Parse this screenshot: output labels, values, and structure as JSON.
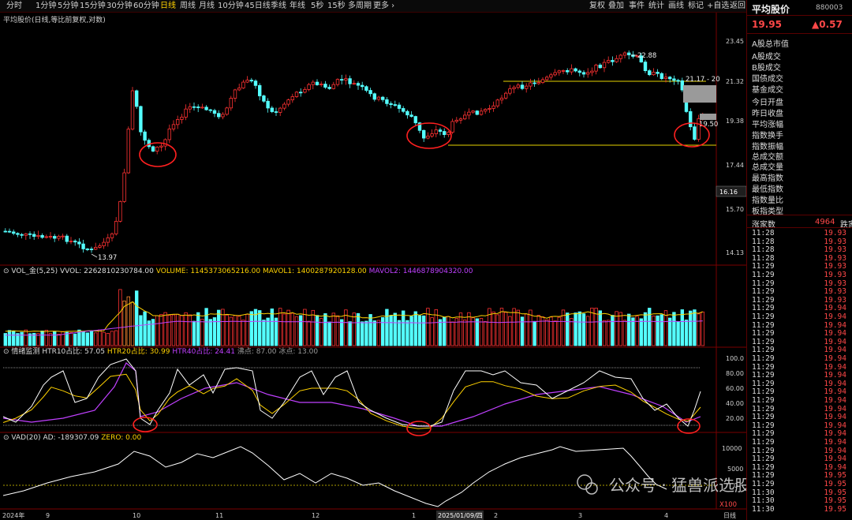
{
  "toolbar": {
    "periods": [
      "分时",
      "1分钟",
      "5分钟",
      "15分钟",
      "30分钟",
      "60分钟",
      "日线",
      "周线",
      "月线",
      "10分钟",
      "45日线",
      "季线",
      "年线",
      "5秒",
      "15秒",
      "多周期",
      "更多 ›"
    ],
    "active_period": "日线",
    "right_buttons": [
      "复权",
      "叠加",
      "事件",
      "统计",
      "画线",
      "标记",
      "+自选",
      "返回"
    ]
  },
  "main_chart": {
    "title": "平均股价(日线,等比前复权,对数)",
    "price_axis": [
      "23.45",
      "21.32",
      "19.38",
      "17.44",
      "15.70",
      "14.13"
    ],
    "current_price_tag": "16.16",
    "annotations": {
      "high": "22.88",
      "low": "13.97",
      "line_right": "21.17 - 20",
      "right_mid": "19.50"
    }
  },
  "volume_panel": {
    "title": "VOL_金(5,25)",
    "vvol": "VVOL: 2262810230784.00",
    "volume": "VOLUME: 1145373065216.00",
    "mavol1": "MAVOL1: 1400287920128.00",
    "mavol2": "MAVOL2: 1446878904320.00"
  },
  "htr_panel": {
    "title": "情绪监测",
    "htr10": "HTR10占比: 57.05",
    "htr20": "HTR20占比: 30.99",
    "htr40": "HTR40占比: 24.41",
    "boil": "沸点: 87.00",
    "freeze": "冰点: 13.00",
    "axis": [
      "100.0",
      "80.00",
      "60.00",
      "40.00",
      "20.00"
    ]
  },
  "vad_panel": {
    "title": "VAD(20)",
    "ad": "AD: -189307.09",
    "zero": "ZERO: 0.00",
    "axis": [
      "10000",
      "5000",
      "0"
    ],
    "unit": "X100"
  },
  "date_axis": {
    "labels": [
      "2024年",
      "9",
      "10",
      "11",
      "12",
      "1",
      "2025/01/09/四",
      "2",
      "3",
      "4"
    ],
    "period_label": "日线"
  },
  "watermark": "公众号 · 猛兽派选股",
  "right_panel": {
    "name": "平均股价",
    "code": "880003",
    "price": "19.95",
    "change": "▲0.57",
    "fields": [
      "A股总市值",
      "A股成交",
      "B股成交",
      "国债成交",
      "基金成交",
      "今日开盘",
      "昨日收盘",
      "平均涨幅",
      "指数换手",
      "指数振幅",
      "总成交额",
      "总成交量",
      "最高指数",
      "最低指数",
      "指数量比",
      "板指类型"
    ],
    "rise_label": "涨家数",
    "rise_count": "4964",
    "fall_label": "跌家",
    "ticks": [
      {
        "t": "11:28",
        "p": "19.93"
      },
      {
        "t": "11:28",
        "p": "19.93"
      },
      {
        "t": "11:28",
        "p": "19.93"
      },
      {
        "t": "11:28",
        "p": "19.93"
      },
      {
        "t": "11:29",
        "p": "19.93"
      },
      {
        "t": "11:29",
        "p": "19.93"
      },
      {
        "t": "11:29",
        "p": "19.93"
      },
      {
        "t": "11:29",
        "p": "19.93"
      },
      {
        "t": "11:29",
        "p": "19.93"
      },
      {
        "t": "11:29",
        "p": "19.94"
      },
      {
        "t": "11:29",
        "p": "19.94"
      },
      {
        "t": "11:29",
        "p": "19.94"
      },
      {
        "t": "11:29",
        "p": "19.94"
      },
      {
        "t": "11:29",
        "p": "19.94"
      },
      {
        "t": "11:29",
        "p": "19.94"
      },
      {
        "t": "11:29",
        "p": "19.94"
      },
      {
        "t": "11:29",
        "p": "19.94"
      },
      {
        "t": "11:29",
        "p": "19.94"
      },
      {
        "t": "11:29",
        "p": "19.94"
      },
      {
        "t": "11:29",
        "p": "19.94"
      },
      {
        "t": "11:29",
        "p": "19.94"
      },
      {
        "t": "11:29",
        "p": "19.94"
      },
      {
        "t": "11:29",
        "p": "19.94"
      },
      {
        "t": "11:29",
        "p": "19.94"
      },
      {
        "t": "11:29",
        "p": "19.94"
      },
      {
        "t": "11:29",
        "p": "19.94"
      },
      {
        "t": "11:29",
        "p": "19.94"
      },
      {
        "t": "11:29",
        "p": "19.94"
      },
      {
        "t": "11:29",
        "p": "19.94"
      },
      {
        "t": "11:29",
        "p": "19.95"
      },
      {
        "t": "11:29",
        "p": "19.95"
      },
      {
        "t": "11:30",
        "p": "19.95"
      },
      {
        "t": "11:30",
        "p": "19.95"
      },
      {
        "t": "11:30",
        "p": "19.95"
      }
    ]
  },
  "colors": {
    "up": "#ff3232",
    "down": "#54ffff",
    "yellow": "#ffd200",
    "magenta": "#c040ff",
    "white": "#ffffff"
  }
}
